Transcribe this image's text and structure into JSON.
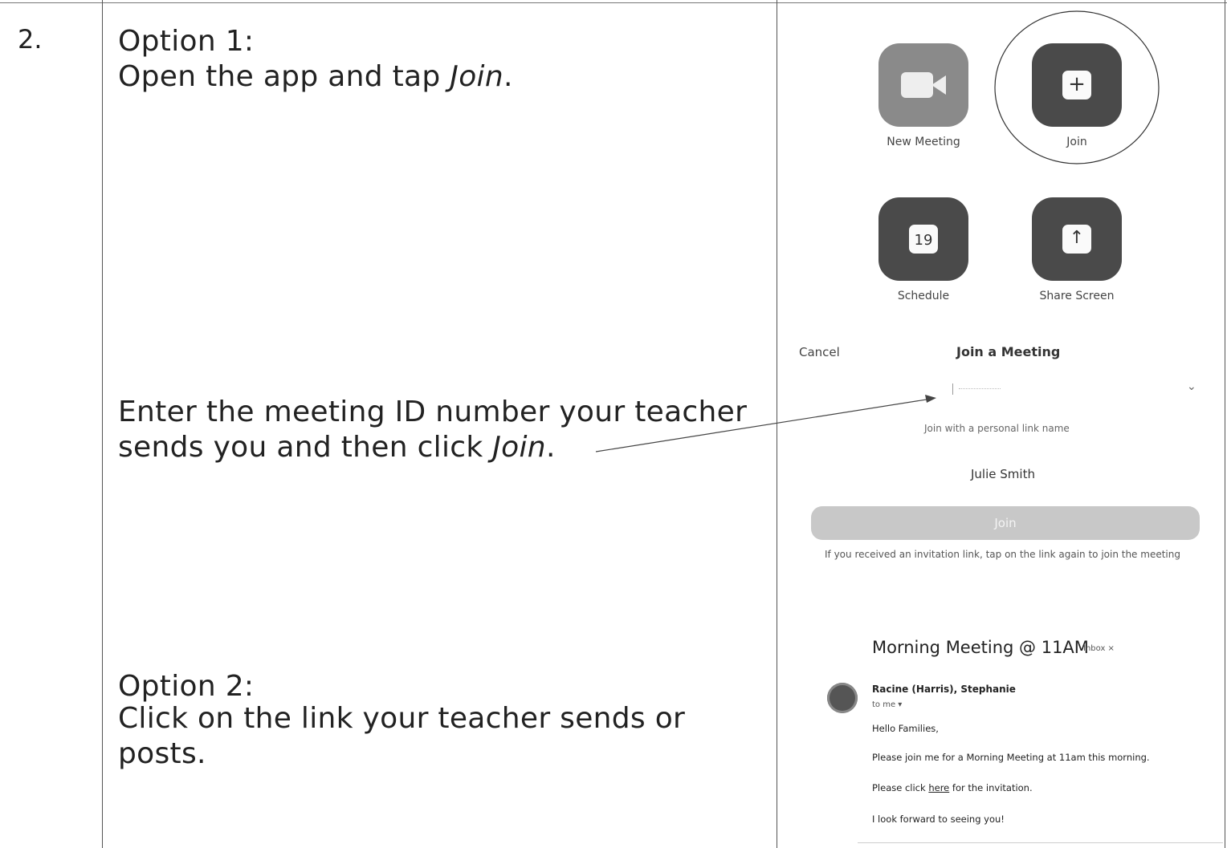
{
  "step": {
    "number": "2."
  },
  "instructions": {
    "option1_heading": "Option 1:",
    "option1_text_before": "Open the app and tap ",
    "option1_text_em": "Join",
    "option1_text_after": ".",
    "enter_line1": "Enter the meeting ID number your teacher",
    "enter_line2_before": "sends you and then click ",
    "enter_line2_em": "Join",
    "enter_line2_after": ".",
    "option2_heading": "Option 2:",
    "option2_line1": "Click on the link your teacher sends or",
    "option2_line2": "posts."
  },
  "zoom_home": {
    "tiles": [
      {
        "label": "New Meeting",
        "icon": "video-camera-icon"
      },
      {
        "label": "Join",
        "icon": "plus-icon",
        "glyph": "+"
      },
      {
        "label": "Schedule",
        "icon": "calendar-icon",
        "glyph": "19"
      },
      {
        "label": "Share Screen",
        "icon": "upload-arrow-icon",
        "glyph": "↑"
      }
    ]
  },
  "join_dialog": {
    "cancel": "Cancel",
    "title": "Join a Meeting",
    "dropdown_glyph": "⌄",
    "personal_link": "Join with a personal link name",
    "name_value": "Julie Smith",
    "join_button": "Join",
    "invitation_note": "If you received an invitation link, tap on the link again to join the meeting"
  },
  "email": {
    "subject": "Morning Meeting @ 11AM",
    "badge": "Inbox ×",
    "sender": "Racine (Harris), Stephanie",
    "recipient": "to me ▾",
    "greeting": "Hello Families,",
    "body1": "Please join me for a Morning Meeting at 11am this morning.",
    "body2_before": "Please click ",
    "body2_link": "here",
    "body2_after": " for the invitation.",
    "closing": "I look forward to seeing you!"
  },
  "colors": {
    "tile_dark": "#4a4a4a",
    "tile_light": "#8a8a8a",
    "join_button": "#c8c8c8"
  }
}
